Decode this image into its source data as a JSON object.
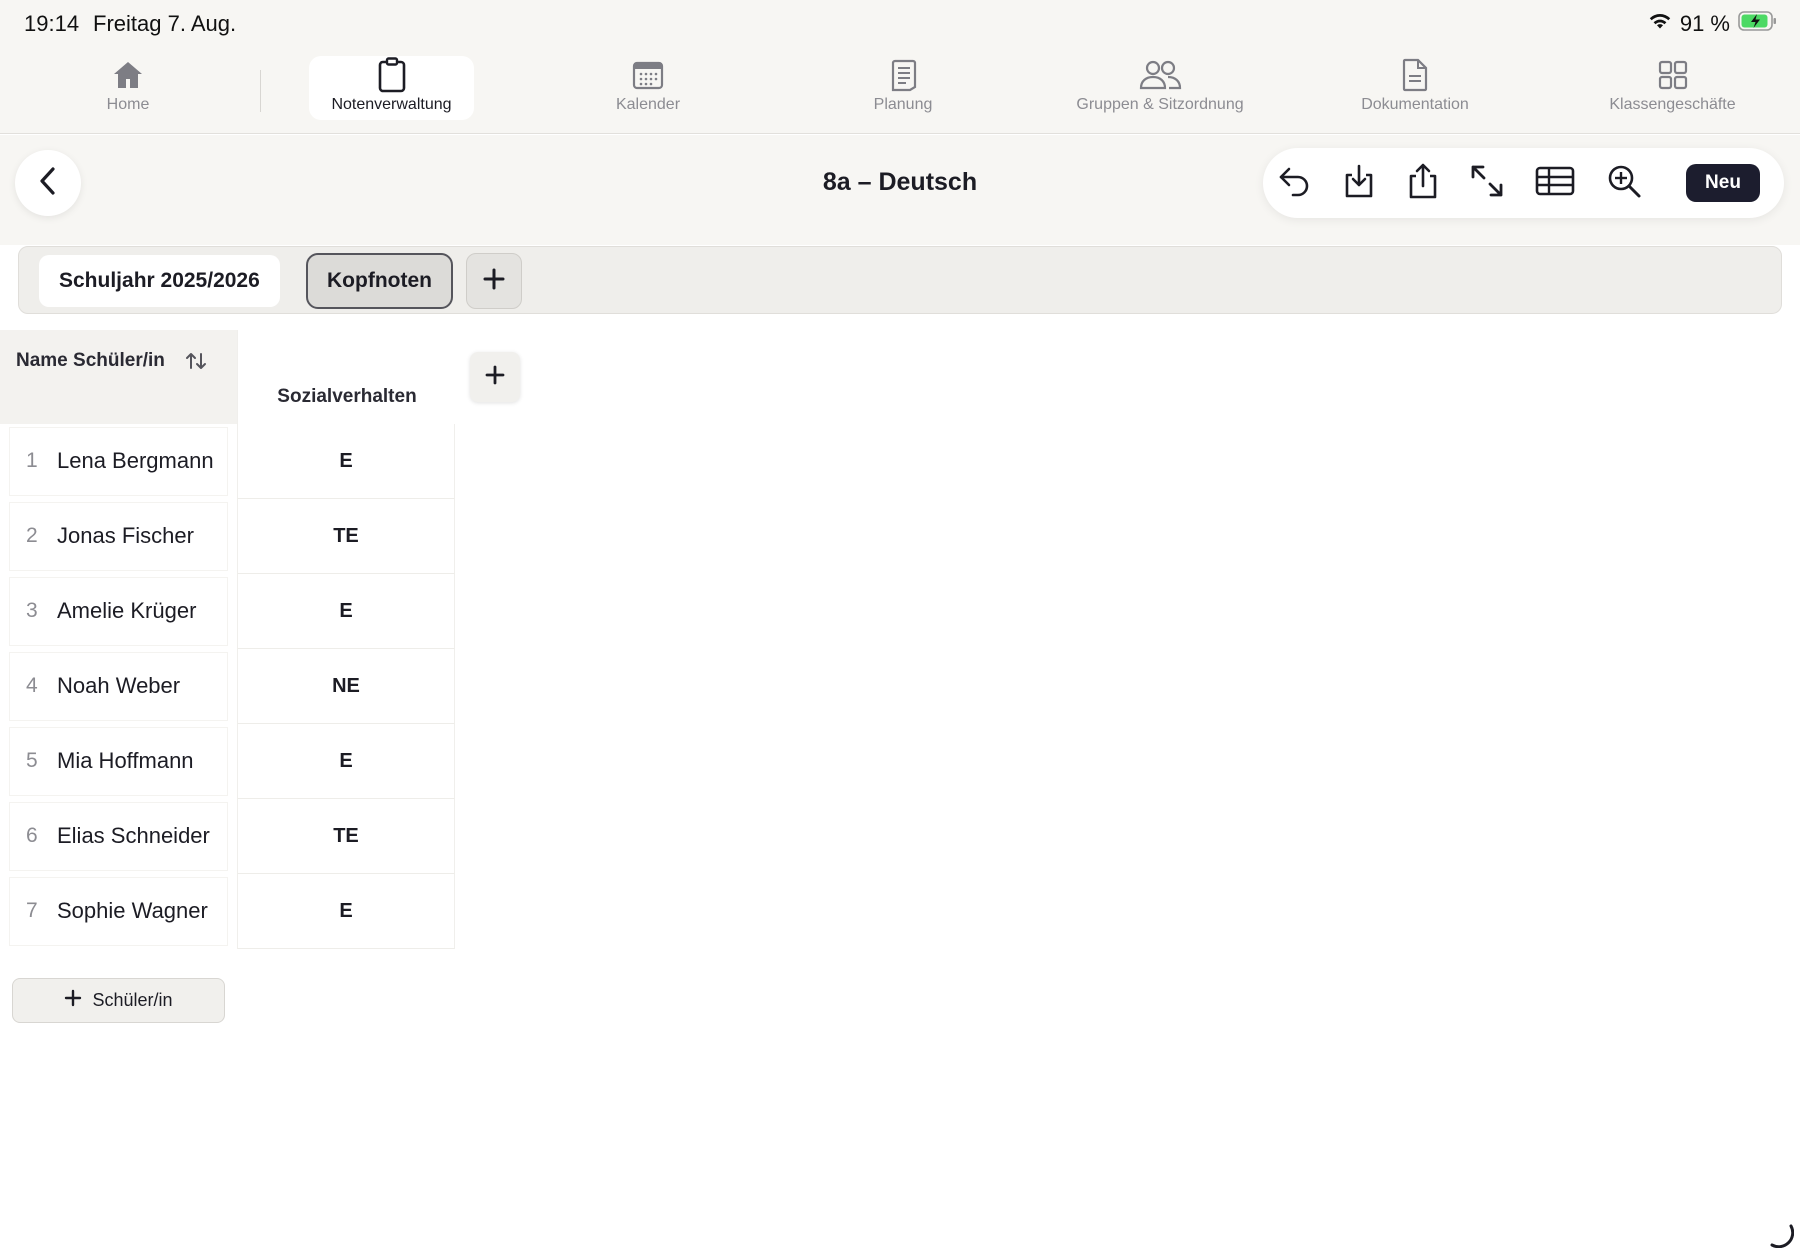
{
  "status": {
    "time": "19:14",
    "date": "Freitag 7. Aug.",
    "battery": "91 %"
  },
  "tabs": [
    {
      "label": "Home",
      "icon": "home-icon"
    },
    {
      "label": "Notenverwaltung",
      "icon": "clipboard-icon",
      "active": true
    },
    {
      "label": "Kalender",
      "icon": "calendar-icon"
    },
    {
      "label": "Planung",
      "icon": "notebook-icon"
    },
    {
      "label": "Gruppen & Sitzordnung",
      "icon": "people-icon"
    },
    {
      "label": "Dokumentation",
      "icon": "document-icon"
    },
    {
      "label": "Klassengeschäfte",
      "icon": "grid-icon"
    }
  ],
  "header": {
    "title": "8a – Deutsch",
    "new_label": "Neu"
  },
  "period_tabs": {
    "year": "Schuljahr 2025/2026",
    "category": "Kopfnoten"
  },
  "table": {
    "name_header": "Name Schüler/in",
    "column_header": "Sozialverhalten",
    "rows": [
      {
        "num": "1",
        "name": "Lena Bergmann",
        "grade": "E"
      },
      {
        "num": "2",
        "name": "Jonas Fischer",
        "grade": "TE"
      },
      {
        "num": "3",
        "name": "Amelie Krüger",
        "grade": "E"
      },
      {
        "num": "4",
        "name": "Noah Weber",
        "grade": "NE"
      },
      {
        "num": "5",
        "name": "Mia Hoffmann",
        "grade": "E"
      },
      {
        "num": "6",
        "name": "Elias Schneider",
        "grade": "TE"
      },
      {
        "num": "7",
        "name": "Sophie Wagner",
        "grade": "E"
      }
    ]
  },
  "add_student_label": "Schüler/in",
  "colors": {
    "accent": "#1c1d2e",
    "background": "#f7f6f3",
    "battery": "#4cd964"
  }
}
